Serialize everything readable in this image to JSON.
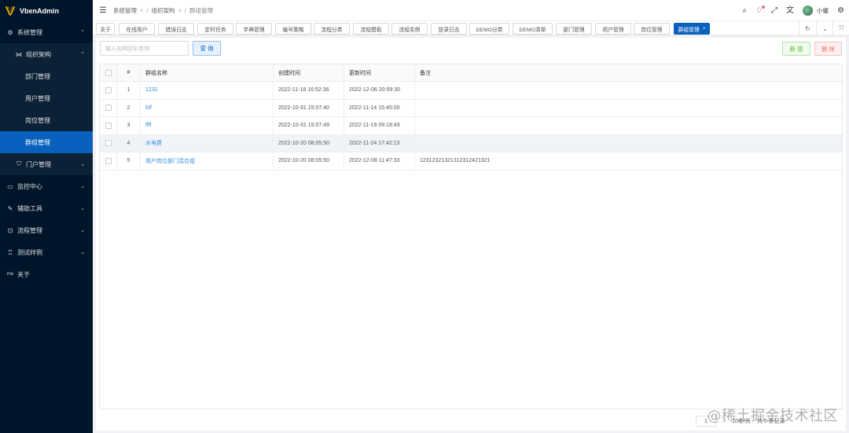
{
  "app": {
    "name": "VbenAdmin"
  },
  "sidebar": {
    "system": {
      "label": "系统管理"
    },
    "org": {
      "label": "组织架构"
    },
    "org_items": [
      {
        "label": "部门管理"
      },
      {
        "label": "用户管理"
      },
      {
        "label": "岗位管理"
      },
      {
        "label": "群组管理"
      }
    ],
    "portal": {
      "label": "门户管理"
    },
    "monitor": {
      "label": "监控中心"
    },
    "tools": {
      "label": "辅助工具"
    },
    "flow": {
      "label": "流程管理"
    },
    "demo": {
      "label": "测试样例"
    },
    "about": {
      "label": "关于",
      "icon_text": "me"
    }
  },
  "header": {
    "breadcrumb": [
      "系统管理",
      "组织架构",
      "群组管理"
    ],
    "user_name": "小催"
  },
  "tabs": [
    {
      "label": "关于"
    },
    {
      "label": "在线用户"
    },
    {
      "label": "错误日志"
    },
    {
      "label": "定时任务"
    },
    {
      "label": "字典管理"
    },
    {
      "label": "编号策略"
    },
    {
      "label": "流程分类"
    },
    {
      "label": "流程模板"
    },
    {
      "label": "流程实例"
    },
    {
      "label": "登录日志"
    },
    {
      "label": "DEMO分类"
    },
    {
      "label": "DEMO清单"
    },
    {
      "label": "部门管理"
    },
    {
      "label": "用户管理"
    },
    {
      "label": "岗位管理"
    },
    {
      "label": "群组管理",
      "active": true
    }
  ],
  "toolbar": {
    "search_placeholder": "输入名称回车查询",
    "query_label": "查 询",
    "add_label": "新 增",
    "delete_label": "删 除"
  },
  "table": {
    "headers": [
      "#",
      "群组名称",
      "创建时间",
      "更新时间",
      "备注"
    ],
    "rows": [
      {
        "idx": "1",
        "name": "1232",
        "created": "2022-11-18 16:52:36",
        "updated": "2022-12-06 20:59:30",
        "remark": ""
      },
      {
        "idx": "2",
        "name": "fdf",
        "created": "2022-10-31 15:07:40",
        "updated": "2022-11-14 15:45:00",
        "remark": ""
      },
      {
        "idx": "3",
        "name": "ffff",
        "created": "2022-10-31 15:07:49",
        "updated": "2022-11-19 09:19:43",
        "remark": ""
      },
      {
        "idx": "4",
        "name": "水电费",
        "created": "2022-10-20 08:05:50",
        "updated": "2022-11-24 17:42:13",
        "remark": ""
      },
      {
        "idx": "5",
        "name": "用户岗位部门混合组",
        "created": "2022-10-20 08:05:50",
        "updated": "2022-12-08 11:47:33",
        "remark": "12312321321312312421321"
      }
    ]
  },
  "pagination": {
    "current": "1",
    "next": ">",
    "page_size": "10条/页",
    "total": "共 5 条记录"
  },
  "watermark": "@稀土掘金技术社区"
}
